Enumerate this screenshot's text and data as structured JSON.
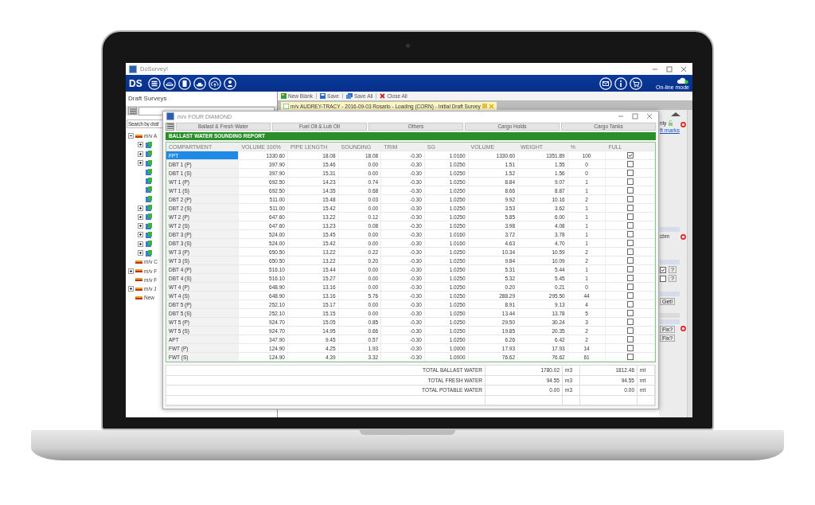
{
  "app": {
    "title": "DoSurvey!",
    "logo": "DS",
    "online_label": "On-line mode"
  },
  "left_panel": {
    "title": "Draft Surveys",
    "search": {
      "placeholder": "Search by draf"
    },
    "tree": [
      {
        "label": "m/v A",
        "kind": "minus"
      },
      {
        "label": "m/v C",
        "kind": "none"
      },
      {
        "label": "m/v F",
        "kind": "plus"
      },
      {
        "label": "m/v F",
        "kind": "none"
      },
      {
        "label": "m/v J",
        "kind": "plus"
      },
      {
        "label": "New",
        "kind": "none"
      }
    ]
  },
  "doc_toolbar": [
    {
      "label": "New Blank",
      "kind": "new"
    },
    {
      "label": "Save",
      "kind": "save"
    },
    {
      "label": "Save All",
      "kind": "save_all"
    },
    {
      "label": "Close All",
      "kind": "close"
    }
  ],
  "doc_tab": {
    "label": "m/v AUDREY-TRACY - 2016-09-03 Rosario - Loading (CORN) - Initial Draft Survey"
  },
  "right_strip": {
    "text_1": "nly",
    "link": "ft marks",
    "unit": "cbm",
    "checks": [
      {
        "checked": true,
        "button": "?"
      },
      {
        "checked": false,
        "button": "?"
      }
    ],
    "get_button": "Get!",
    "fix_buttons": [
      "Fix?",
      "Fix?"
    ]
  },
  "dialog": {
    "title": "m/v FOUR DIAMOND",
    "tabs": [
      "Ballast & Fresh Water",
      "Fuel Oil & Lub Oil",
      "Others",
      "Cargo Holds",
      "Cargo Tanks"
    ],
    "report_title": "BALLAST WATER SOUNDING REPORT",
    "columns": [
      "COMPARTMENT",
      "VOLUME 100%",
      "PIPE LENGTH",
      "SOUNDING",
      "TRIM",
      "SG",
      "VOLUME",
      "WEIGHT",
      "%",
      "FULL"
    ],
    "rows": [
      {
        "cells": [
          "FPT",
          "1330.60",
          "18.08",
          "18.08",
          "-0.30",
          "1.0160",
          "1330.60",
          "1351.89",
          "100"
        ],
        "full": true,
        "selected": true
      },
      {
        "cells": [
          "DBT 1 (P)",
          "397.90",
          "15.46",
          "0.00",
          "-0.30",
          "1.0250",
          "1.51",
          "1.55",
          "0"
        ],
        "full": false,
        "selected": false
      },
      {
        "cells": [
          "DBT 1 (S)",
          "397.90",
          "15.31",
          "0.00",
          "-0.30",
          "1.0250",
          "1.52",
          "1.56",
          "0"
        ],
        "full": false,
        "selected": false
      },
      {
        "cells": [
          "WT 1 (P)",
          "692.50",
          "14.23",
          "0.74",
          "-0.30",
          "1.0250",
          "8.84",
          "9.07",
          "1"
        ],
        "full": false,
        "selected": false
      },
      {
        "cells": [
          "WT 1 (S)",
          "692.50",
          "14.35",
          "0.68",
          "-0.30",
          "1.0250",
          "8.66",
          "8.87",
          "1"
        ],
        "full": false,
        "selected": false
      },
      {
        "cells": [
          "DBT 2 (P)",
          "511.00",
          "15.48",
          "0.03",
          "-0.30",
          "1.0250",
          "9.92",
          "10.16",
          "2"
        ],
        "full": false,
        "selected": false
      },
      {
        "cells": [
          "DBT 2 (S)",
          "511.00",
          "15.42",
          "0.00",
          "-0.30",
          "1.0250",
          "3.53",
          "3.62",
          "1"
        ],
        "full": false,
        "selected": false
      },
      {
        "cells": [
          "WT 2 (P)",
          "647.60",
          "13.22",
          "0.12",
          "-0.30",
          "1.0250",
          "5.85",
          "6.00",
          "1"
        ],
        "full": false,
        "selected": false
      },
      {
        "cells": [
          "WT 2 (S)",
          "647.60",
          "13.23",
          "0.08",
          "-0.30",
          "1.0250",
          "3.98",
          "4.08",
          "1"
        ],
        "full": false,
        "selected": false
      },
      {
        "cells": [
          "DBT 3 (P)",
          "524.00",
          "15.45",
          "0.00",
          "-0.30",
          "1.0160",
          "3.72",
          "3.78",
          "1"
        ],
        "full": false,
        "selected": false
      },
      {
        "cells": [
          "DBT 3 (S)",
          "524.00",
          "15.42",
          "0.00",
          "-0.30",
          "1.0160",
          "4.63",
          "4.70",
          "1"
        ],
        "full": false,
        "selected": false
      },
      {
        "cells": [
          "WT 3 (P)",
          "650.50",
          "13.22",
          "0.22",
          "-0.30",
          "1.0250",
          "10.34",
          "10.59",
          "2"
        ],
        "full": false,
        "selected": false
      },
      {
        "cells": [
          "WT 3 (S)",
          "650.50",
          "13.22",
          "0.20",
          "-0.30",
          "1.0250",
          "9.84",
          "10.09",
          "2"
        ],
        "full": false,
        "selected": false
      },
      {
        "cells": [
          "DBT 4 (P)",
          "516.10",
          "15.44",
          "0.00",
          "-0.30",
          "1.0250",
          "5.31",
          "5.44",
          "1"
        ],
        "full": false,
        "selected": false
      },
      {
        "cells": [
          "DBT 4 (S)",
          "516.10",
          "15.27",
          "0.00",
          "-0.30",
          "1.0250",
          "5.32",
          "5.45",
          "1"
        ],
        "full": false,
        "selected": false
      },
      {
        "cells": [
          "WT 4 (P)",
          "648.90",
          "13.16",
          "0.00",
          "-0.30",
          "1.0250",
          "0.20",
          "0.21",
          "0"
        ],
        "full": false,
        "selected": false
      },
      {
        "cells": [
          "WT 4 (S)",
          "648.90",
          "13.16",
          "5.76",
          "-0.30",
          "1.0250",
          "288.29",
          "295.50",
          "44"
        ],
        "full": false,
        "selected": false
      },
      {
        "cells": [
          "DBT 5 (P)",
          "252.10",
          "15.17",
          "0.00",
          "-0.30",
          "1.0250",
          "8.91",
          "9.13",
          "4"
        ],
        "full": false,
        "selected": false
      },
      {
        "cells": [
          "DBT 5 (S)",
          "252.10",
          "15.15",
          "0.00",
          "-0.30",
          "1.0250",
          "13.44",
          "13.78",
          "5"
        ],
        "full": false,
        "selected": false
      },
      {
        "cells": [
          "WT 5 (P)",
          "924.70",
          "15.05",
          "0.85",
          "-0.30",
          "1.0250",
          "29.50",
          "30.24",
          "3"
        ],
        "full": false,
        "selected": false
      },
      {
        "cells": [
          "WT 5 (S)",
          "924.70",
          "14.95",
          "0.66",
          "-0.30",
          "1.0250",
          "19.85",
          "20.35",
          "2"
        ],
        "full": false,
        "selected": false
      },
      {
        "cells": [
          "APT",
          "347.90",
          "9.45",
          "0.57",
          "-0.30",
          "1.0250",
          "6.26",
          "6.42",
          "2"
        ],
        "full": false,
        "selected": false
      },
      {
        "cells": [
          "FWT (P)",
          "124.90",
          "4.25",
          "1.93",
          "-0.30",
          "1.0000",
          "17.93",
          "17.93",
          "14"
        ],
        "full": false,
        "selected": false
      },
      {
        "cells": [
          "FWT (S)",
          "124.90",
          "4.39",
          "3.32",
          "-0.30",
          "1.0000",
          "76.62",
          "76.62",
          "61"
        ],
        "full": false,
        "selected": false
      }
    ],
    "totals": [
      {
        "label": "TOTAL BALLAST WATER",
        "volume": "1780.02",
        "volume_unit": "m3",
        "weight": "1812.46",
        "weight_unit": "mt"
      },
      {
        "label": "TOTAL FRESH WATER",
        "volume": "94.55",
        "volume_unit": "m3",
        "weight": "94.55",
        "weight_unit": "mt"
      },
      {
        "label": "TOTAL POTABLE WATER",
        "volume": "0.00",
        "volume_unit": "m3",
        "weight": "0.00",
        "weight_unit": "mt"
      }
    ]
  }
}
